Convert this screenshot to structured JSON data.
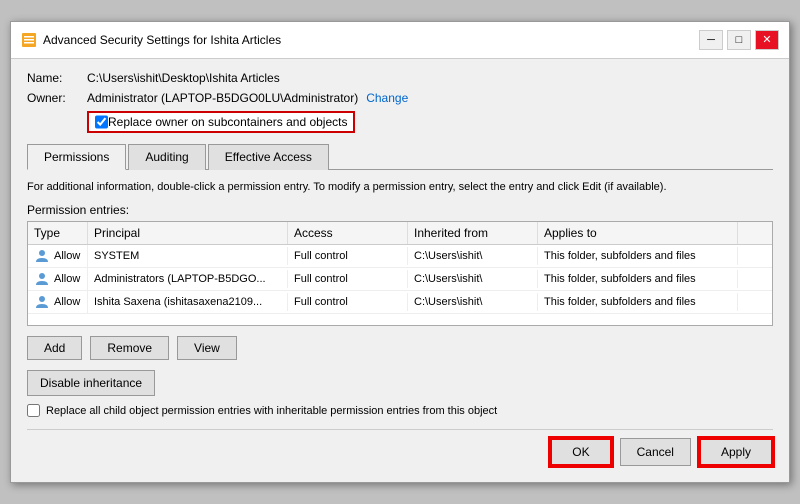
{
  "window": {
    "title": "Advanced Security Settings for Ishita Articles"
  },
  "name_label": "Name:",
  "name_value": "C:\\Users\\ishit\\Desktop\\Ishita Articles",
  "owner_label": "Owner:",
  "owner_value": "Administrator (LAPTOP-B5DGO0LU\\Administrator)",
  "change_link": "Change",
  "replace_owner_checkbox": {
    "label": "Replace owner on subcontainers and objects",
    "checked": true
  },
  "tabs": [
    {
      "label": "Permissions",
      "active": true
    },
    {
      "label": "Auditing",
      "active": false
    },
    {
      "label": "Effective Access",
      "active": false
    }
  ],
  "info_text": "For additional information, double-click a permission entry. To modify a permission entry, select the entry and click Edit (if available).",
  "permission_entries_label": "Permission entries:",
  "table_headers": [
    "Type",
    "Principal",
    "Access",
    "Inherited from",
    "Applies to"
  ],
  "table_rows": [
    {
      "type": "Allow",
      "principal": "SYSTEM",
      "access": "Full control",
      "inherited_from": "C:\\Users\\ishit\\",
      "applies_to": "This folder, subfolders and files"
    },
    {
      "type": "Allow",
      "principal": "Administrators (LAPTOP-B5DGO...",
      "access": "Full control",
      "inherited_from": "C:\\Users\\ishit\\",
      "applies_to": "This folder, subfolders and files"
    },
    {
      "type": "Allow",
      "principal": "Ishita Saxena (ishitasaxena2109...",
      "access": "Full control",
      "inherited_from": "C:\\Users\\ishit\\",
      "applies_to": "This folder, subfolders and files"
    }
  ],
  "buttons": {
    "add": "Add",
    "remove": "Remove",
    "view": "View"
  },
  "disable_inheritance_btn": "Disable inheritance",
  "replace_all_checkbox": {
    "label": "Replace all child object permission entries with inheritable permission entries from this object",
    "checked": false
  },
  "bottom_buttons": {
    "ok": "OK",
    "cancel": "Cancel",
    "apply": "Apply"
  }
}
